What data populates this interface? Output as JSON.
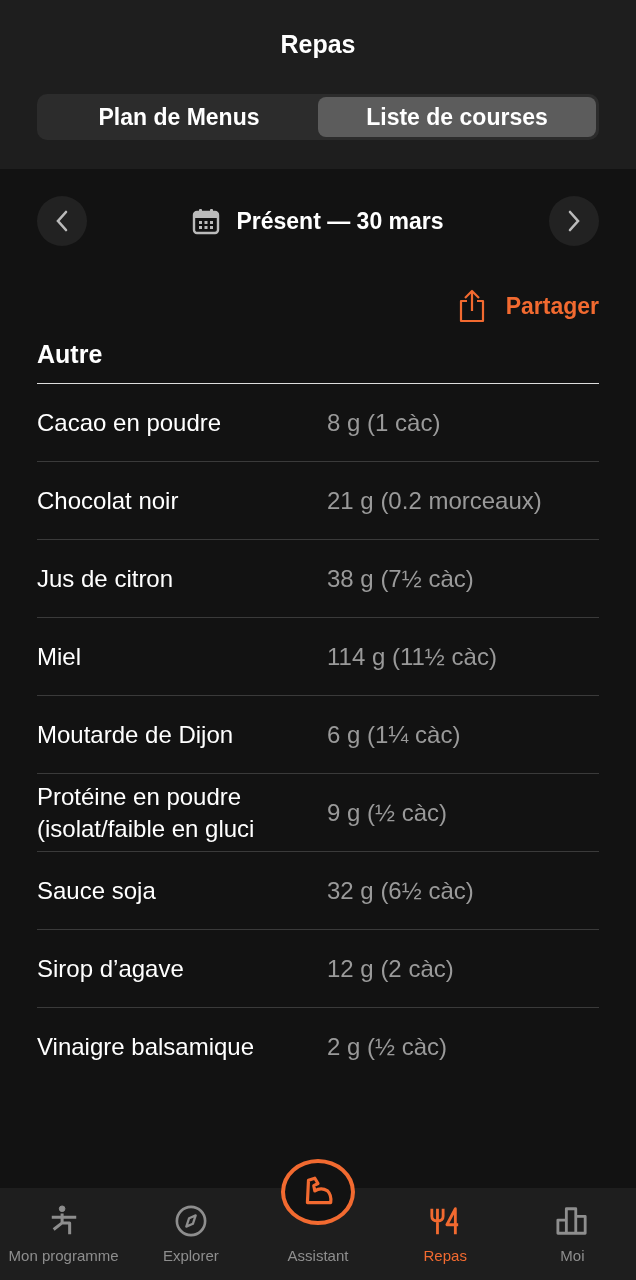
{
  "title": "Repas",
  "tabs": [
    {
      "label": "Plan de Menus",
      "selected": false
    },
    {
      "label": "Liste de courses",
      "selected": true
    }
  ],
  "period": "Présent — 30 mars",
  "share": "Partager",
  "section": "Autre",
  "items": [
    {
      "name": "Cacao en poudre",
      "amount": "8 g (1 càc)"
    },
    {
      "name": "Chocolat noir",
      "amount": "21 g (0.2 morceaux)"
    },
    {
      "name": "Jus de citron",
      "amount": "38 g (7½ càc)"
    },
    {
      "name": "Miel",
      "amount": "114 g (11½ càc)"
    },
    {
      "name": "Moutarde de Dijon",
      "amount": "6 g (1¼ càc)"
    },
    {
      "name": "Protéine en poudre (isolat/faible en gluci",
      "amount": "9 g (½ càc)"
    },
    {
      "name": "Sauce soja",
      "amount": "32 g (6½ càc)"
    },
    {
      "name": "Sirop d’agave",
      "amount": "12 g (2 càc)"
    },
    {
      "name": "Vinaigre balsamique",
      "amount": "2 g (½ càc)"
    }
  ],
  "nav": [
    {
      "label": "Mon programme",
      "kind": "figure",
      "selected": false
    },
    {
      "label": "Explorer",
      "kind": "compass",
      "selected": false
    },
    {
      "label": "Assistant",
      "kind": "arm",
      "selected": false
    },
    {
      "label": "Repas",
      "kind": "fork",
      "selected": true
    },
    {
      "label": "Moi",
      "kind": "chart",
      "selected": false
    }
  ]
}
